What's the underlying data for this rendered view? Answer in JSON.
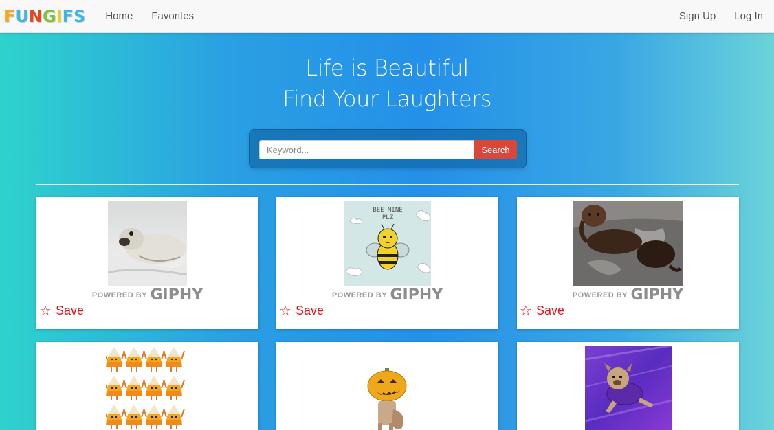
{
  "navbar": {
    "logo": [
      "F",
      "U",
      "N",
      "G",
      "I",
      "F",
      "S"
    ],
    "logo_colors": [
      "#f7a51b",
      "#3cb8e8",
      "#e8451d",
      "#7dc242",
      "#f7c81b",
      "#3cb8e8",
      "#3cb8e8"
    ],
    "links_left": [
      "Home",
      "Favorites"
    ],
    "links_right": [
      "Sign Up",
      "Log In"
    ]
  },
  "hero": {
    "line1": "Life is Beautiful",
    "line2": "Find Your Laughters"
  },
  "search": {
    "placeholder": "Keyword...",
    "value": "",
    "button_label": "Search"
  },
  "cards": [
    {
      "gif": "seal",
      "powered_by": "POWERED BY",
      "brand": "GIPHY",
      "save_label": "Save"
    },
    {
      "gif": "bee",
      "caption": "BEE MINE PLZ",
      "powered_by": "POWERED BY",
      "brand": "GIPHY",
      "save_label": "Save"
    },
    {
      "gif": "dachshunds",
      "powered_by": "POWERED BY",
      "brand": "GIPHY",
      "save_label": "Save"
    },
    {
      "gif": "candy-corn-dancers"
    },
    {
      "gif": "pumpkin-head"
    },
    {
      "gif": "flying-bulldog"
    }
  ],
  "colors": {
    "save": "#e8141f",
    "search_button": "#d9463a"
  }
}
